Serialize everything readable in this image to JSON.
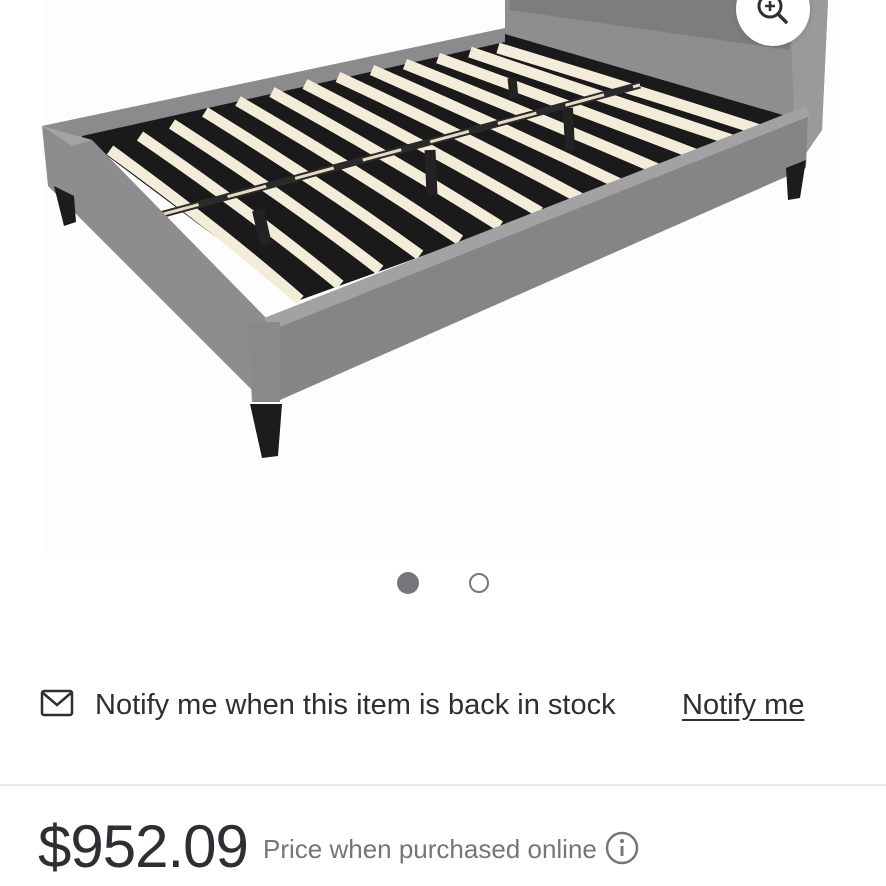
{
  "product": {
    "image_alt": "Grey upholstered platform bed frame with wooden slats",
    "carousel": {
      "slide_count": 2,
      "active_index": 0
    }
  },
  "icons": {
    "zoom": "zoom-in-icon",
    "mail": "mail-icon",
    "info": "info-icon"
  },
  "notify": {
    "message": "Notify me when this item is back in stock",
    "link_label": "Notify me"
  },
  "pricing": {
    "price": "$952.09",
    "price_note": "Price when purchased online"
  },
  "colors": {
    "text_primary": "#2e2f32",
    "text_secondary": "#74767c",
    "divider": "#e6e7e8"
  }
}
